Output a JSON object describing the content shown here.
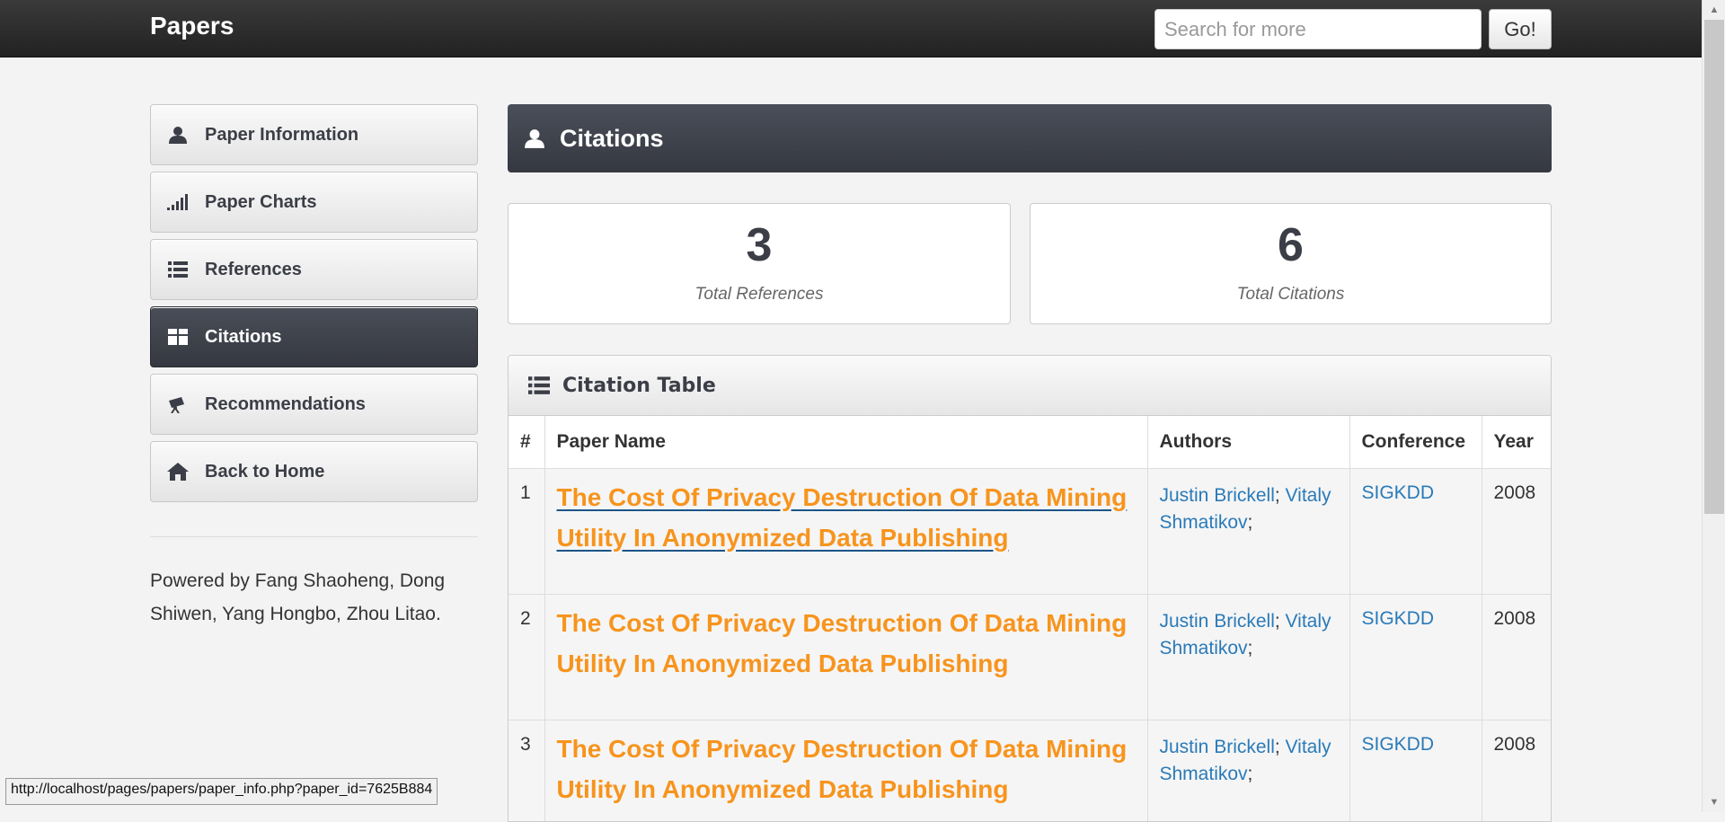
{
  "topbar": {
    "brand": "Papers",
    "search_placeholder": "Search for more",
    "go_label": "Go!"
  },
  "sidebar": {
    "items": [
      {
        "label": "Paper Information",
        "icon": "user-icon",
        "active": false
      },
      {
        "label": "Paper Charts",
        "icon": "signal-bars-icon",
        "active": false
      },
      {
        "label": "References",
        "icon": "list-icon",
        "active": false
      },
      {
        "label": "Citations",
        "icon": "grid-icon",
        "active": true
      },
      {
        "label": "Recommendations",
        "icon": "telescope-icon",
        "active": false
      },
      {
        "label": "Back to Home",
        "icon": "home-icon",
        "active": false
      }
    ],
    "footer": "Powered by Fang Shaoheng, Dong Shiwen, Yang Hongbo, Zhou Litao."
  },
  "main": {
    "header_title": "Citations",
    "stats": [
      {
        "value": "3",
        "label": "Total References"
      },
      {
        "value": "6",
        "label": "Total Citations"
      }
    ],
    "table": {
      "title": "Citation Table",
      "columns": [
        "#",
        "Paper Name",
        "Authors",
        "Conference",
        "Year"
      ],
      "rows": [
        {
          "num": "1",
          "paper": "The Cost Of Privacy Destruction Of Data Mining Utility In Anonymized Data Publishing",
          "author1": "Justin Brickell",
          "author2": "Vitaly Shmatikov",
          "conference": "SIGKDD",
          "year": "2008"
        },
        {
          "num": "2",
          "paper": "The Cost Of Privacy Destruction Of Data Mining Utility In Anonymized Data Publishing",
          "author1": "Justin Brickell",
          "author2": "Vitaly Shmatikov",
          "conference": "SIGKDD",
          "year": "2008"
        },
        {
          "num": "3",
          "paper": "The Cost Of Privacy Destruction Of Data Mining Utility In Anonymized Data Publishing",
          "author1": "Justin Brickell",
          "author2": "Vitaly Shmatikov",
          "conference": "SIGKDD",
          "year": "2008"
        }
      ]
    }
  },
  "status_bar": {
    "url": "http://localhost/pages/papers/paper_info.php?paper_id=7625B884"
  },
  "colors": {
    "accent_dark": "#3b3e46",
    "link_orange": "#f7941d",
    "link_blue": "#2a7ab8"
  }
}
